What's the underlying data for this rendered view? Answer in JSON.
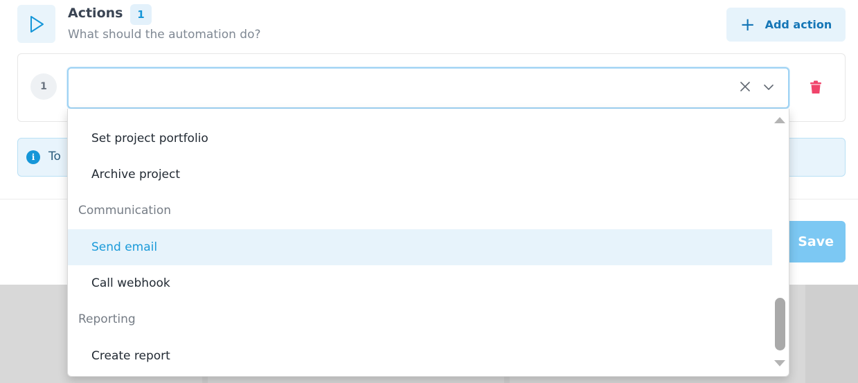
{
  "header": {
    "title": "Actions",
    "count": "1",
    "subtitle": "What should the automation do?",
    "add_button_label": "Add action",
    "play_icon": "play-icon"
  },
  "action": {
    "step_number": "1",
    "select_value": "",
    "clear_icon": "close-icon",
    "expand_icon": "chevron-down-icon",
    "delete_icon": "trash-icon"
  },
  "info": {
    "icon": "info-icon",
    "text": "To"
  },
  "footer": {
    "save_label": "Save"
  },
  "dropdown": {
    "options": [
      {
        "label": "Set project portfolio",
        "type": "item"
      },
      {
        "label": "Archive project",
        "type": "item"
      },
      {
        "label": "Communication",
        "type": "group"
      },
      {
        "label": "Send email",
        "type": "item",
        "highlighted": true
      },
      {
        "label": "Call webhook",
        "type": "item"
      },
      {
        "label": "Reporting",
        "type": "group"
      },
      {
        "label": "Create report",
        "type": "item"
      }
    ]
  },
  "colors": {
    "accent": "#1596d8",
    "danger": "#f0446b",
    "save_button": "#7cc8f3",
    "highlight_bg": "#e7f3fb"
  }
}
